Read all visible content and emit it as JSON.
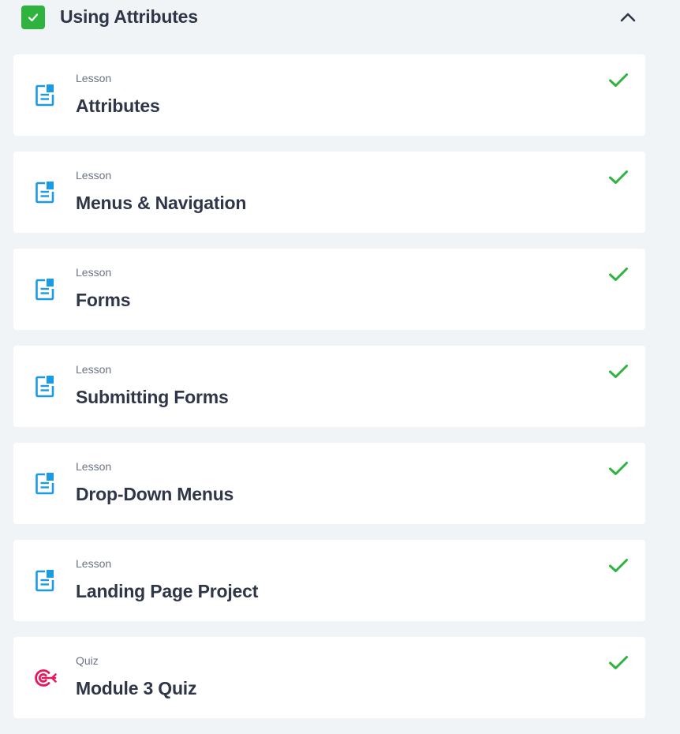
{
  "module": {
    "title": "Using Attributes",
    "completed": true,
    "expanded": true
  },
  "items": [
    {
      "type": "Lesson",
      "title": "Attributes",
      "icon": "lesson-doc-icon",
      "completed": true
    },
    {
      "type": "Lesson",
      "title": "Menus & Navigation",
      "icon": "lesson-doc-icon",
      "completed": true
    },
    {
      "type": "Lesson",
      "title": "Forms",
      "icon": "lesson-doc-icon",
      "completed": true
    },
    {
      "type": "Lesson",
      "title": "Submitting Forms",
      "icon": "lesson-doc-icon",
      "completed": true
    },
    {
      "type": "Lesson",
      "title": "Drop-Down Menus",
      "icon": "lesson-doc-icon",
      "completed": true
    },
    {
      "type": "Lesson",
      "title": "Landing Page Project",
      "icon": "lesson-doc-icon",
      "completed": true
    },
    {
      "type": "Quiz",
      "title": "Module 3 Quiz",
      "icon": "quiz-target-icon",
      "completed": true
    }
  ],
  "colors": {
    "background": "#f1f4f7",
    "card": "#ffffff",
    "title_text": "#2e3648",
    "type_text": "#6b7384",
    "complete_green": "#2fb33f",
    "lesson_blue": "#1a9be6",
    "quiz_pink": "#e8185c"
  }
}
